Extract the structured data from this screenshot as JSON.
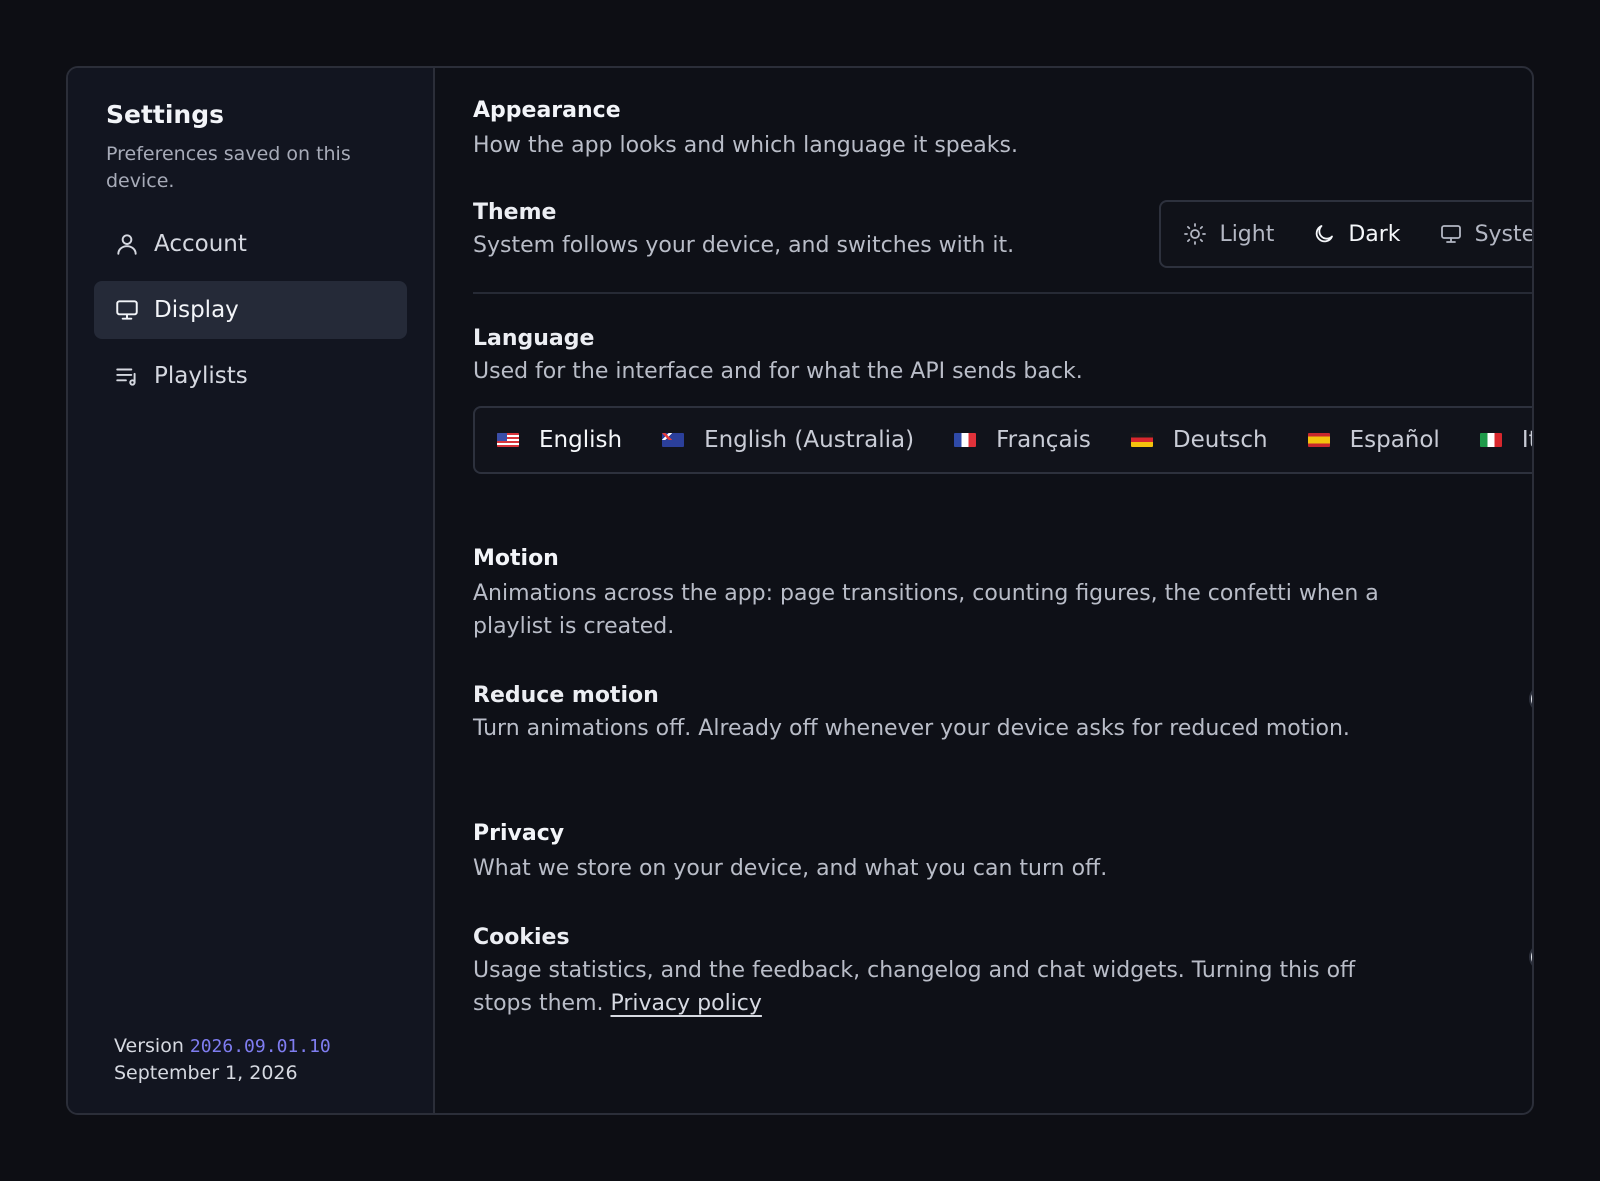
{
  "sidebar": {
    "title": "Settings",
    "subtitle": "Preferences saved on this device.",
    "items": [
      {
        "label": "Account",
        "icon": "user-icon"
      },
      {
        "label": "Display",
        "icon": "monitor-icon",
        "active": true
      },
      {
        "label": "Playlists",
        "icon": "playlist-icon"
      }
    ],
    "version_label": "Version",
    "version_number": "2026.09.01.10",
    "version_date": "September 1, 2026"
  },
  "appearance": {
    "title": "Appearance",
    "description": "How the app looks and which language it speaks."
  },
  "theme": {
    "title": "Theme",
    "description": "System follows your device, and switches with it.",
    "options": [
      {
        "label": "Light",
        "icon": "sun-icon"
      },
      {
        "label": "Dark",
        "icon": "moon-icon",
        "active": true
      },
      {
        "label": "System",
        "icon": "monitor-icon"
      }
    ]
  },
  "language": {
    "title": "Language",
    "description": "Used for the interface and for what the API sends back.",
    "options": [
      {
        "label": "English",
        "flag": "us",
        "active": true
      },
      {
        "label": "English (Australia)",
        "flag": "au"
      },
      {
        "label": "Français",
        "flag": "fr"
      },
      {
        "label": "Deutsch",
        "flag": "de"
      },
      {
        "label": "Español",
        "flag": "es"
      },
      {
        "label": "Italia",
        "flag": "it"
      }
    ]
  },
  "motion": {
    "title": "Motion",
    "description": "Animations across the app: page transitions, counting figures, the confetti when a playlist is created.",
    "reduce_title": "Reduce motion",
    "reduce_description": "Turn animations off. Already off whenever your device asks for reduced motion.",
    "reduce_enabled": false
  },
  "privacy": {
    "title": "Privacy",
    "description": "What we store on your device, and what you can turn off.",
    "cookies_title": "Cookies",
    "cookies_description": "Usage statistics, and the feedback, changelog and chat widgets. Turning this off stops them.",
    "cookies_link": "Privacy policy",
    "cookies_enabled": false
  },
  "colors": {
    "background": "#0d0e14",
    "sidebar": "#121520",
    "active_item": "#252a38",
    "version_accent": "#7f7df0"
  }
}
